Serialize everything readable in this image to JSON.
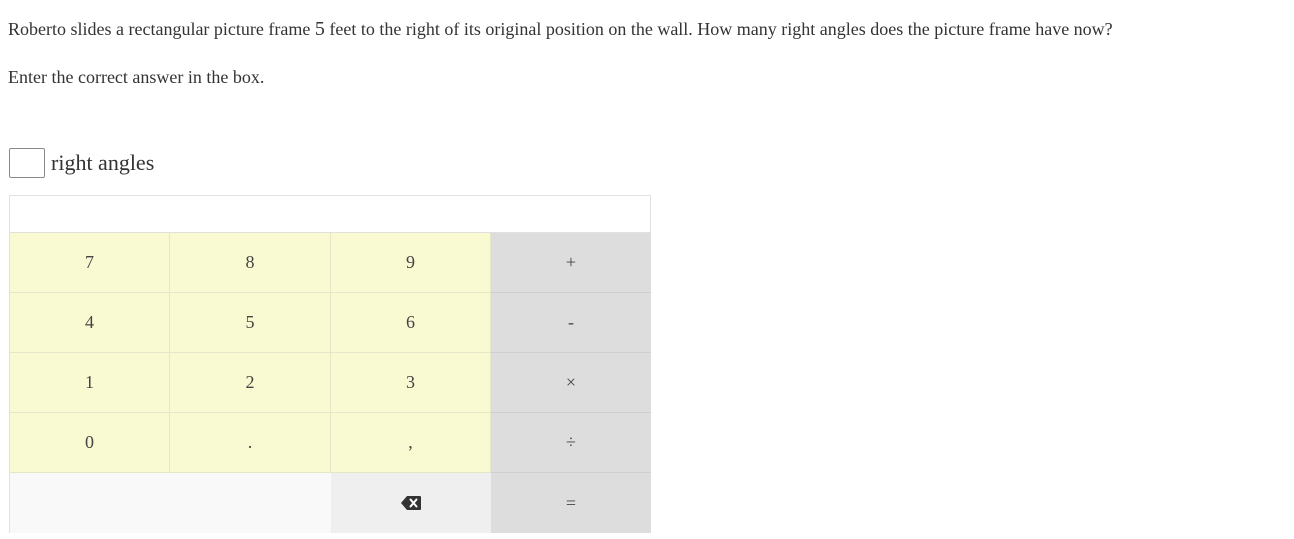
{
  "question": {
    "text_before": "Roberto slides a rectangular picture frame ",
    "number": "5",
    "text_after": " feet to the right of its original position on the wall. How many right angles does the picture frame have now?"
  },
  "instruction": "Enter the correct answer in the box.",
  "answer": {
    "value": "",
    "suffix": "right angles"
  },
  "keypad": {
    "display": "",
    "keys": {
      "seven": "7",
      "eight": "8",
      "nine": "9",
      "plus": "+",
      "four": "4",
      "five": "5",
      "six": "6",
      "minus": "-",
      "one": "1",
      "two": "2",
      "three": "3",
      "times": "×",
      "zero": "0",
      "decimal": ".",
      "comma": ",",
      "divide": "÷",
      "equals": "="
    },
    "backspace_icon": "backspace-icon",
    "colors": {
      "number_keys": "#fafad2",
      "operator_keys": "#dddddd",
      "blank_area": "#f9f9f9",
      "backspace_key": "#efefef"
    }
  }
}
